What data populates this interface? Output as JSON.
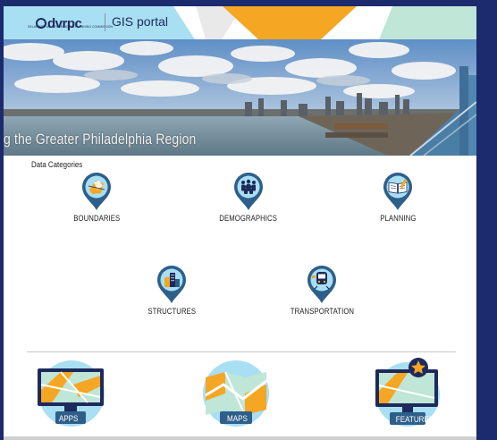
{
  "header": {
    "logo_text": "dvrpc",
    "logo_subtext": "DELAWARE VALLEY REGIONAL PLANNING COMMISSION",
    "title": "GIS portal",
    "colors": {
      "cyan": "#a9dff3",
      "orange": "#f5a623",
      "mint": "#bfe6d6"
    }
  },
  "banner": {
    "caption": "g the Greater Philadelphia Region"
  },
  "categories": {
    "label": "Data Categories",
    "items": [
      {
        "label": "BOUNDARIES",
        "icon": "boundaries-map-icon"
      },
      {
        "label": "DEMOGRAPHICS",
        "icon": "people-group-icon"
      },
      {
        "label": "PLANNING",
        "icon": "open-book-icon"
      },
      {
        "label": "STRUCTURES",
        "icon": "buildings-icon"
      },
      {
        "label": "TRANSPORTATION",
        "icon": "train-icon"
      }
    ]
  },
  "features": [
    {
      "label": "APPS",
      "icon": "monitor-map-icon"
    },
    {
      "label": "MAPS",
      "icon": "map-icon"
    },
    {
      "label": "FEATURED",
      "icon": "star-monitor-icon"
    }
  ],
  "theme": {
    "navy": "#1d2a5b",
    "pin_blue": "#2e5f8a",
    "circle_light": "#a9dff3"
  }
}
